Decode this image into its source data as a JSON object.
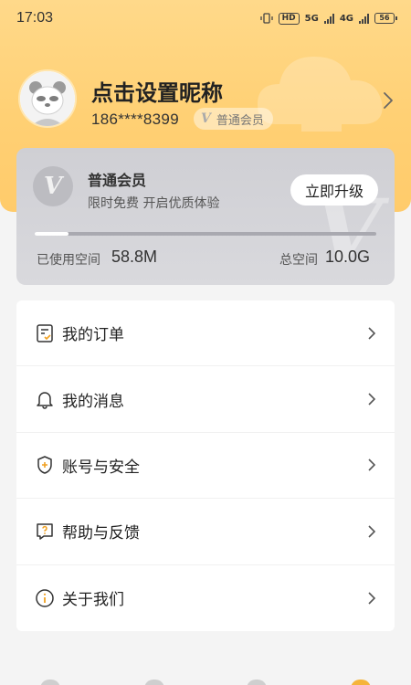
{
  "status_bar": {
    "time": "17:03",
    "hd_label": "HD",
    "network_5g": "5G",
    "network_4g": "4G",
    "battery": "56"
  },
  "profile": {
    "nickname": "点击设置昵称",
    "phone": "186****8399",
    "badge_icon_letter": "V",
    "member_level": "普通会员"
  },
  "membership_card": {
    "logo_letter": "V",
    "title": "普通会员",
    "subtitle": "限时免费 开启优质体验",
    "upgrade_label": "立即升级",
    "used_label": "已使用空间",
    "used_value": "58.8M",
    "total_label": "总空间",
    "total_value": "10.0G",
    "usage_fraction": 0.1
  },
  "menu": {
    "items": [
      {
        "label": "我的订单",
        "icon": "order-icon"
      },
      {
        "label": "我的消息",
        "icon": "bell-icon"
      },
      {
        "label": "账号与安全",
        "icon": "shield-icon"
      },
      {
        "label": "帮助与反馈",
        "icon": "help-icon"
      },
      {
        "label": "关于我们",
        "icon": "info-icon"
      }
    ]
  },
  "colors": {
    "header_gradient_start": "#ffd98a",
    "header_gradient_end": "#ffcb6b",
    "card_bg": "#d3d3d8",
    "page_bg": "#f4f4f4"
  }
}
